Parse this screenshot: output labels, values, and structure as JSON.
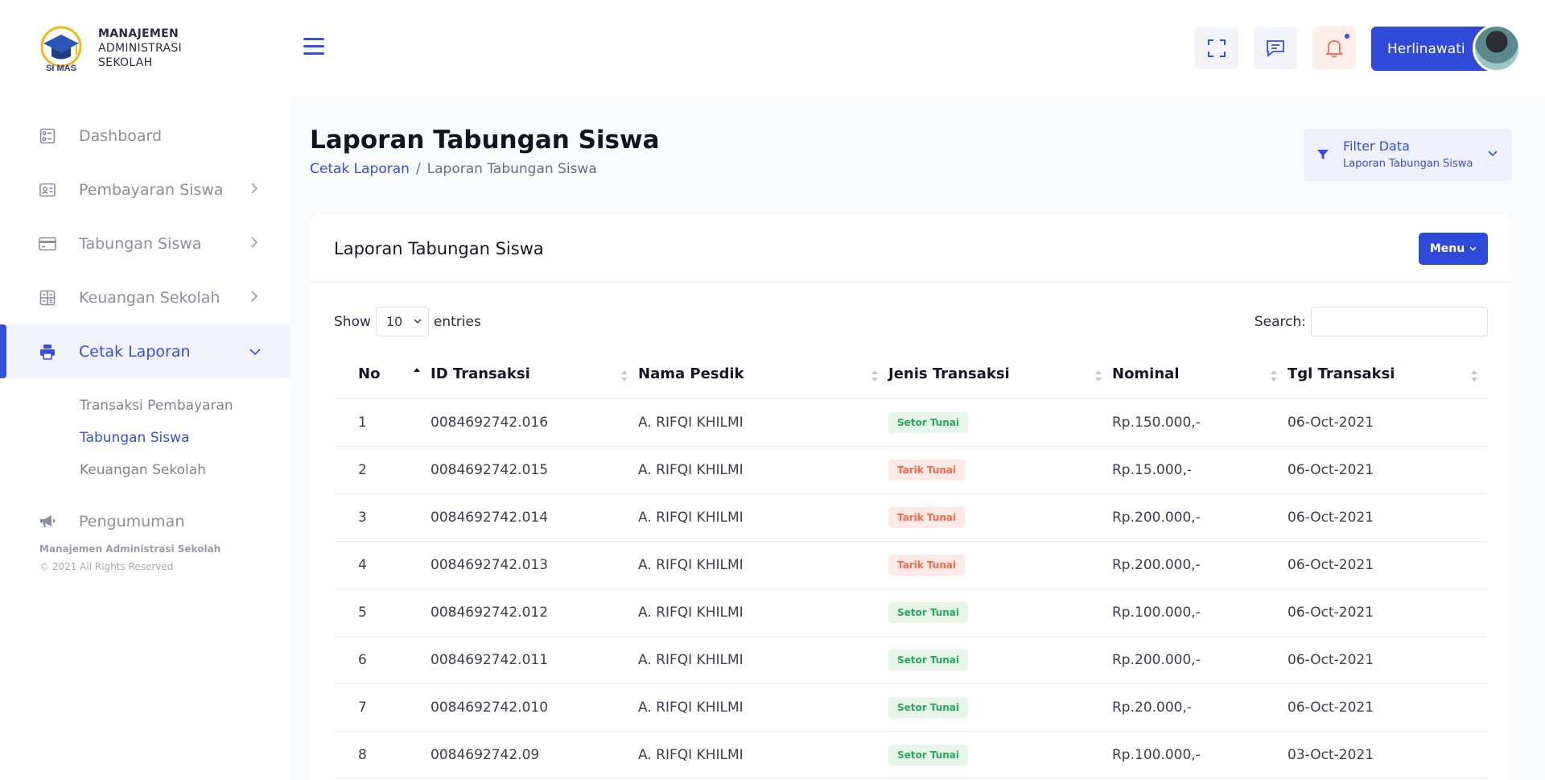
{
  "brand": {
    "logo_text": "SI MAS",
    "line1": "MANAJEMEN",
    "line2": "ADMINISTRASI",
    "line3": "SEKOLAH"
  },
  "sidebar": {
    "items": [
      {
        "label": "Dashboard",
        "icon": "dashboard-icon"
      },
      {
        "label": "Pembayaran Siswa",
        "icon": "id-card-icon"
      },
      {
        "label": "Tabungan Siswa",
        "icon": "credit-card-icon"
      },
      {
        "label": "Keuangan Sekolah",
        "icon": "calculator-icon"
      },
      {
        "label": "Cetak Laporan",
        "icon": "printer-icon"
      }
    ],
    "submenu": [
      "Transaksi Pembayaran",
      "Tabungan Siswa",
      "Keuangan Sekolah"
    ],
    "announcement": {
      "label": "Pengumuman",
      "icon": "megaphone-icon"
    },
    "footer_line1": "Manajemen Administrasi Sekolah",
    "footer_line2": "© 2021 All Rights Reserved"
  },
  "topbar": {
    "user_name": "Herlinawati"
  },
  "page": {
    "title": "Laporan Tabungan Siswa",
    "breadcrumb_link": "Cetak Laporan",
    "breadcrumb_sep": "/",
    "breadcrumb_current": "Laporan Tabungan Siswa",
    "filter_title": "Filter Data",
    "filter_subtitle": "Laporan Tabungan Siswa"
  },
  "card": {
    "title": "Laporan Tabungan Siswa",
    "menu_label": "Menu",
    "show_label": "Show",
    "entries_value": "10",
    "entries_label": "entries",
    "search_label": "Search:"
  },
  "table": {
    "headers": [
      "No",
      "ID Transaksi",
      "Nama Pesdik",
      "Jenis Transaksi",
      "Nominal",
      "Tgl Transaksi"
    ],
    "rows": [
      {
        "no": "1",
        "id": "0084692742.016",
        "nama": "A. RIFQI KHILMI",
        "jenis": "Setor Tunai",
        "type": "setor",
        "nominal": "Rp.150.000,-",
        "tgl": "06-Oct-2021"
      },
      {
        "no": "2",
        "id": "0084692742.015",
        "nama": "A. RIFQI KHILMI",
        "jenis": "Tarik Tunai",
        "type": "tarik",
        "nominal": "Rp.15.000,-",
        "tgl": "06-Oct-2021"
      },
      {
        "no": "3",
        "id": "0084692742.014",
        "nama": "A. RIFQI KHILMI",
        "jenis": "Tarik Tunai",
        "type": "tarik",
        "nominal": "Rp.200.000,-",
        "tgl": "06-Oct-2021"
      },
      {
        "no": "4",
        "id": "0084692742.013",
        "nama": "A. RIFQI KHILMI",
        "jenis": "Tarik Tunai",
        "type": "tarik",
        "nominal": "Rp.200.000,-",
        "tgl": "06-Oct-2021"
      },
      {
        "no": "5",
        "id": "0084692742.012",
        "nama": "A. RIFQI KHILMI",
        "jenis": "Setor Tunai",
        "type": "setor",
        "nominal": "Rp.100.000,-",
        "tgl": "06-Oct-2021"
      },
      {
        "no": "6",
        "id": "0084692742.011",
        "nama": "A. RIFQI KHILMI",
        "jenis": "Setor Tunai",
        "type": "setor",
        "nominal": "Rp.200.000,-",
        "tgl": "06-Oct-2021"
      },
      {
        "no": "7",
        "id": "0084692742.010",
        "nama": "A. RIFQI KHILMI",
        "jenis": "Setor Tunai",
        "type": "setor",
        "nominal": "Rp.20.000,-",
        "tgl": "06-Oct-2021"
      },
      {
        "no": "8",
        "id": "0084692742.09",
        "nama": "A. RIFQI KHILMI",
        "jenis": "Setor Tunai",
        "type": "setor",
        "nominal": "Rp.100.000,-",
        "tgl": "03-Oct-2021"
      }
    ]
  },
  "colors": {
    "accent": "#3550dc",
    "setor": "#2aa85a",
    "tarik": "#ef6a4c"
  }
}
